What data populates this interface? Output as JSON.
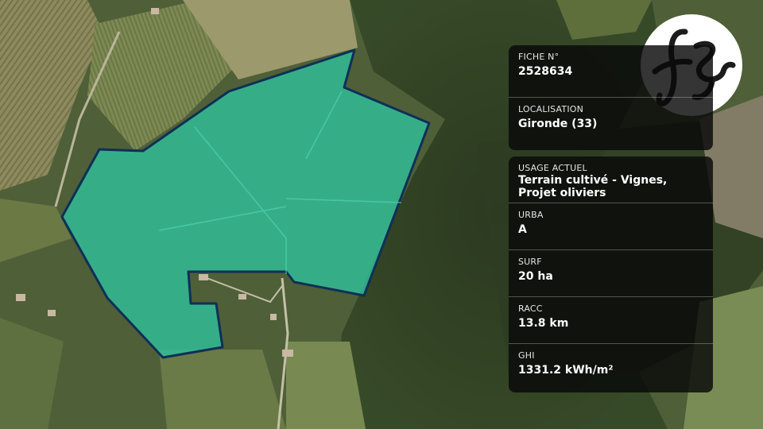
{
  "colors": {
    "parcel_fill": "#2fbf9a",
    "parcel_outline": "#0f2f57",
    "card_background": "#080808",
    "logo_mark": "#1c1c1c"
  },
  "logo": {
    "icon": "fs-monogram-logo"
  },
  "fiche": {
    "label": "FICHE N°",
    "value": "2528634"
  },
  "localisation": {
    "label": "LOCALISATION",
    "value": "Gironde (33)"
  },
  "usage": {
    "label": "USAGE ACTUEL",
    "value": "Terrain cultivé - Vignes, Projet oliviers"
  },
  "urba": {
    "label": "URBA",
    "value": "A"
  },
  "surf": {
    "label": "SURF",
    "value": "20 ha"
  },
  "racc": {
    "label": "RACC",
    "value": "13.8 km"
  },
  "ghi": {
    "label": "GHI",
    "value": "1331.2 kWh/m²"
  }
}
